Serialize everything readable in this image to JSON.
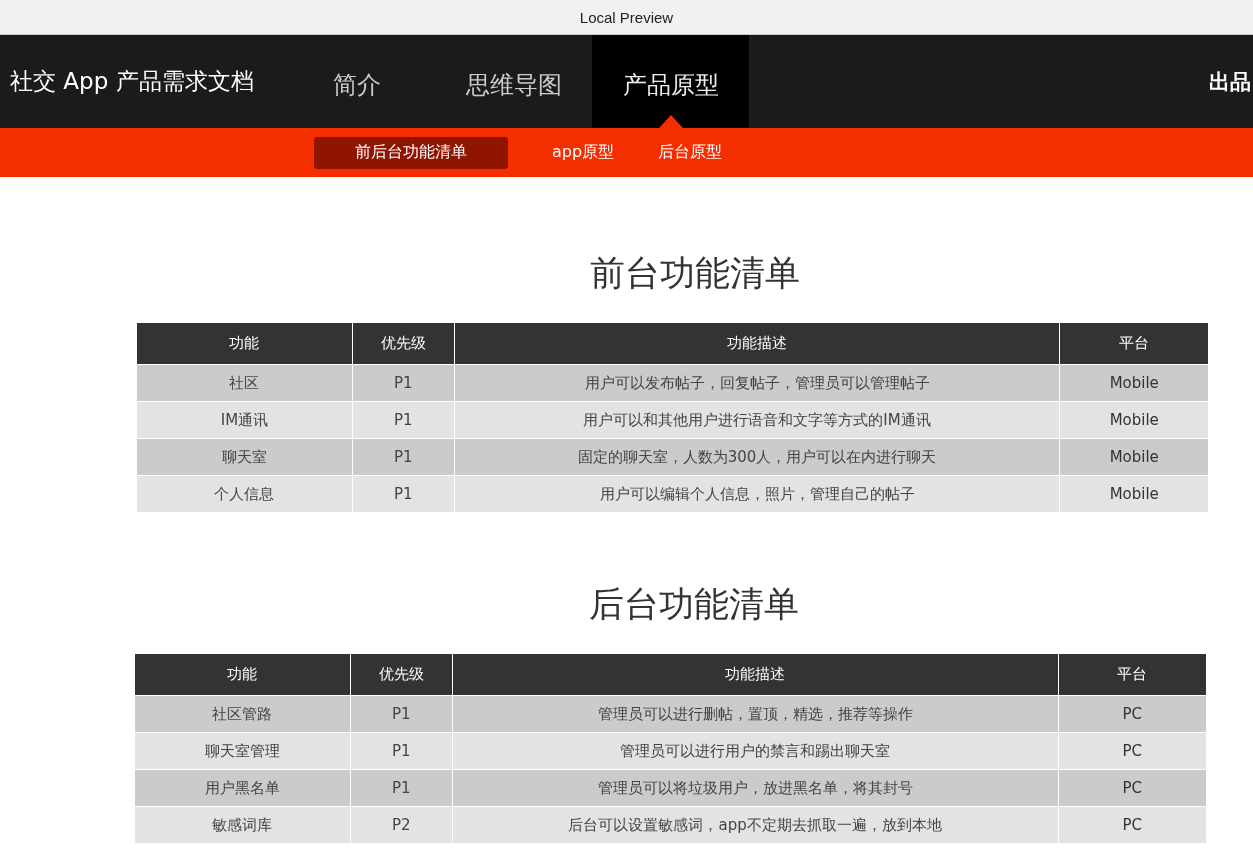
{
  "window": {
    "title": "Local Preview"
  },
  "header": {
    "title": "社交 App 产品需求文档",
    "credit": "出品"
  },
  "tabs": [
    {
      "label": "简介",
      "selected": false
    },
    {
      "label": "思维导图",
      "selected": false
    },
    {
      "label": "产品原型",
      "selected": true
    }
  ],
  "subtabs": [
    {
      "label": "前后台功能清单",
      "selected": true
    },
    {
      "label": "app原型",
      "selected": false
    },
    {
      "label": "后台原型",
      "selected": false
    }
  ],
  "sections": [
    {
      "title": "前台功能清单",
      "columns": [
        "功能",
        "优先级",
        "功能描述",
        "平台"
      ],
      "rows": [
        [
          "社区",
          "P1",
          "用户可以发布帖子，回复帖子，管理员可以管理帖子",
          "Mobile"
        ],
        [
          "IM通讯",
          "P1",
          "用户可以和其他用户进行语音和文字等方式的IM通讯",
          "Mobile"
        ],
        [
          "聊天室",
          "P1",
          "固定的聊天室，人数为300人，用户可以在内进行聊天",
          "Mobile"
        ],
        [
          "个人信息",
          "P1",
          "用户可以编辑个人信息，照片，管理自己的帖子",
          "Mobile"
        ]
      ]
    },
    {
      "title": "后台功能清单",
      "columns": [
        "功能",
        "优先级",
        "功能描述",
        "平台"
      ],
      "rows": [
        [
          "社区管路",
          "P1",
          "管理员可以进行删帖，置顶，精选，推荐等操作",
          "PC"
        ],
        [
          "聊天室管理",
          "P1",
          "管理员可以进行用户的禁言和踢出聊天室",
          "PC"
        ],
        [
          "用户黑名单",
          "P1",
          "管理员可以将垃圾用户，放进黑名单，将其封号",
          "PC"
        ],
        [
          "敏感词库",
          "P2",
          "后台可以设置敏感词，app不定期去抓取一遍，放到本地",
          "PC"
        ]
      ]
    }
  ]
}
